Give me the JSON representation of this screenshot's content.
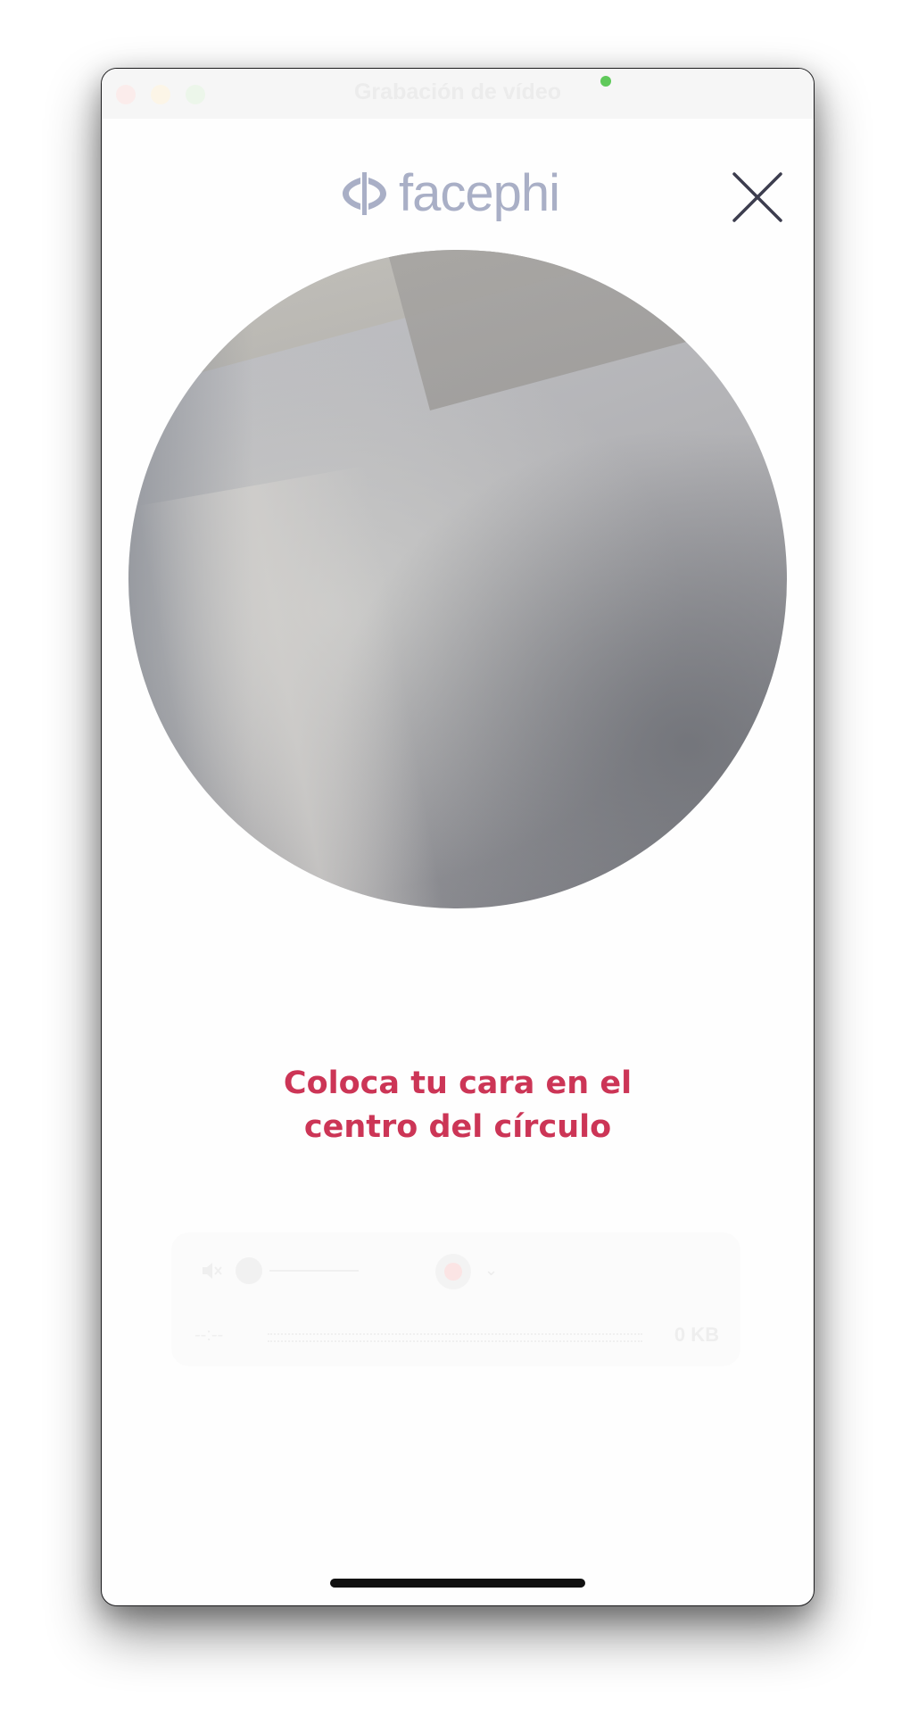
{
  "window": {
    "title": "Grabación de vídeo",
    "recording_indicator_color": "#5fc95a"
  },
  "brand": {
    "logo_text": "facephi",
    "logo_color": "#a9afc6"
  },
  "header": {
    "close_icon": "close-icon",
    "close_color": "#3c3d4e"
  },
  "instruction": {
    "line1": "Coloca tu cara en el",
    "line2": "centro del círculo",
    "color": "#cc3556"
  },
  "recorder": {
    "mute_icon": "speaker-muted-icon",
    "record_icon": "record-icon",
    "chevron_glyph": "⌄",
    "time": "--:--",
    "size": "0 KB"
  }
}
